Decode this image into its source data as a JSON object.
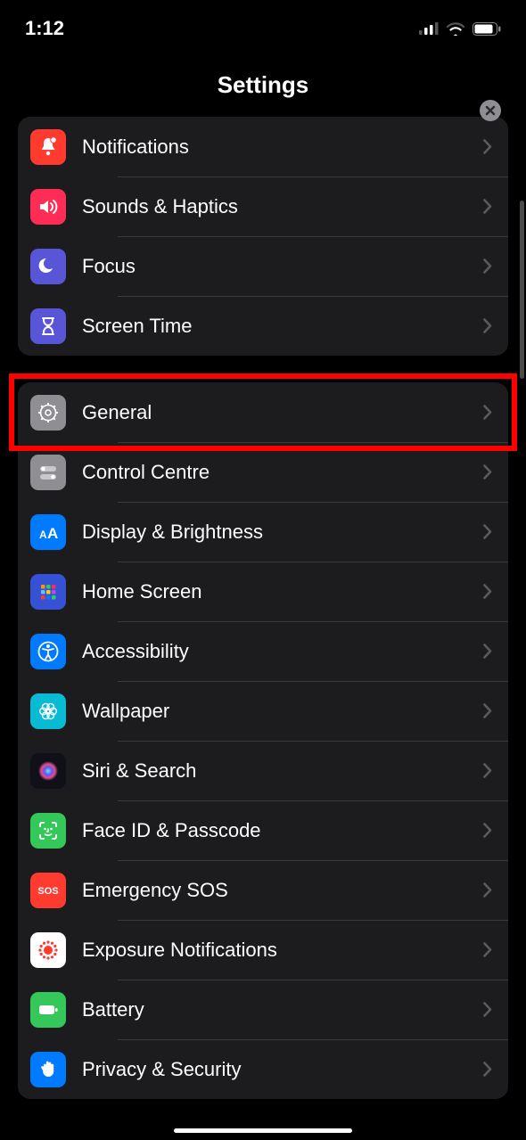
{
  "status": {
    "time": "1:12"
  },
  "header": {
    "title": "Settings"
  },
  "groups": [
    {
      "items": [
        {
          "label": "Notifications",
          "icon": "bell-badge-icon",
          "color": "#ff3b30"
        },
        {
          "label": "Sounds & Haptics",
          "icon": "speaker-icon",
          "color": "#ff2d55"
        },
        {
          "label": "Focus",
          "icon": "moon-icon",
          "color": "#5856d6"
        },
        {
          "label": "Screen Time",
          "icon": "hourglass-icon",
          "color": "#5856d6"
        }
      ]
    },
    {
      "items": [
        {
          "label": "General",
          "icon": "gear-icon",
          "color": "#8e8e93",
          "highlighted": true
        },
        {
          "label": "Control Centre",
          "icon": "switches-icon",
          "color": "#8e8e93"
        },
        {
          "label": "Display & Brightness",
          "icon": "text-size-icon",
          "color": "#007aff"
        },
        {
          "label": "Home Screen",
          "icon": "apps-grid-icon",
          "color": "#3651d3"
        },
        {
          "label": "Accessibility",
          "icon": "accessibility-icon",
          "color": "#007aff"
        },
        {
          "label": "Wallpaper",
          "icon": "flower-icon",
          "color": "#09bad4"
        },
        {
          "label": "Siri & Search",
          "icon": "siri-icon",
          "color": "#101018"
        },
        {
          "label": "Face ID & Passcode",
          "icon": "faceid-icon",
          "color": "#34c759"
        },
        {
          "label": "Emergency SOS",
          "icon": "sos-icon",
          "color": "#ff3b30"
        },
        {
          "label": "Exposure Notifications",
          "icon": "exposure-icon",
          "color": "#ffffff"
        },
        {
          "label": "Battery",
          "icon": "battery-icon",
          "color": "#34c759"
        },
        {
          "label": "Privacy & Security",
          "icon": "hand-icon",
          "color": "#007aff"
        }
      ]
    }
  ]
}
